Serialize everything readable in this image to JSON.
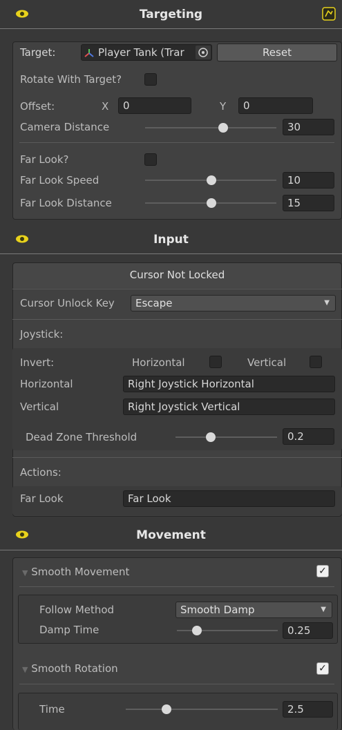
{
  "targeting": {
    "title": "Targeting",
    "target_label": "Target:",
    "target_value": "Player Tank (Trar",
    "reset_label": "Reset",
    "rotate_label": "Rotate With Target?",
    "offset_label": "Offset:",
    "x_label": "X",
    "x_value": "0",
    "y_label": "Y",
    "y_value": "0",
    "camera_distance_label": "Camera Distance",
    "camera_distance_value": "30",
    "camera_distance_level": 0.6,
    "far_look_label": "Far Look?",
    "far_look_speed_label": "Far Look Speed",
    "far_look_speed_value": "10",
    "far_look_speed_level": 0.5,
    "far_look_distance_label": "Far Look Distance",
    "far_look_distance_value": "15",
    "far_look_distance_level": 0.5
  },
  "input": {
    "title": "Input",
    "cursor_lock_button": "Cursor Not Locked",
    "cursor_unlock_key_label": "Cursor Unlock Key",
    "cursor_unlock_key_value": "Escape",
    "joystick_label": "Joystick:",
    "invert_label": "Invert:",
    "horizontal_toggle_label": "Horizontal",
    "vertical_toggle_label": "Vertical",
    "horizontal_label": "Horizontal",
    "horizontal_value": "Right Joystick Horizontal",
    "vertical_label": "Vertical",
    "vertical_value": "Right Joystick Vertical",
    "dead_zone_label": "Dead Zone Threshold",
    "dead_zone_value": "0.2",
    "dead_zone_level": 0.4,
    "actions_label": "Actions:",
    "far_look_label": "Far Look",
    "far_look_value": "Far Look"
  },
  "movement": {
    "title": "Movement",
    "smooth_movement_label": "Smooth Movement",
    "smooth_movement_checked": true,
    "follow_method_label": "Follow Method",
    "follow_method_value": "Smooth Damp",
    "damp_time_label": "Damp Time",
    "damp_time_value": "0.25",
    "damp_time_level": 0.25,
    "smooth_rotation_label": "Smooth Rotation",
    "smooth_rotation_checked": true,
    "time_label": "Time",
    "time_value": "2.5",
    "time_level": 0.25
  },
  "icons": {
    "eye": "eye-icon",
    "script": "script-icon",
    "target": "target-picker-icon",
    "transform": "transform-icon",
    "foldout": "foldout-arrow-icon",
    "dropdown": "dropdown-arrow-icon",
    "check": "checkmark-icon"
  },
  "colors": {
    "background": "#383838",
    "panel": "#414141",
    "field": "#2a2a2a",
    "eye_accent": "#e8d21c"
  }
}
